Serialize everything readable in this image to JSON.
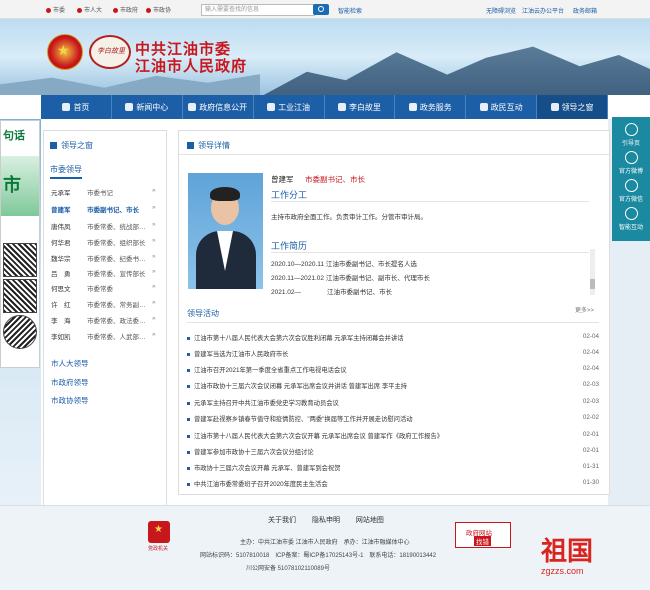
{
  "topbar": {
    "left_links": [
      "市委",
      "市人大",
      "市政府",
      "市政协"
    ],
    "search_placeholder": "输入需要查找的信息",
    "advanced_search": "智能检索",
    "right_links": [
      "无障碍浏览",
      "江油云办公平台",
      "政务邮箱"
    ]
  },
  "header": {
    "title_line1": "中共江油市委",
    "title_line2": "江油市人民政府",
    "logo_text": "李白故里"
  },
  "nav": [
    {
      "label": "首页",
      "icon": "home-icon"
    },
    {
      "label": "新闻中心",
      "icon": "news-icon"
    },
    {
      "label": "政府信息公开",
      "icon": "info-icon"
    },
    {
      "label": "工业江油",
      "icon": "industry-icon"
    },
    {
      "label": "李白故里",
      "icon": "culture-icon"
    },
    {
      "label": "政务服务",
      "icon": "service-icon"
    },
    {
      "label": "政民互动",
      "icon": "interaction-icon"
    },
    {
      "label": "领导之窗",
      "icon": "leader-icon"
    }
  ],
  "left_ad": {
    "text1": "句话",
    "text2": "市"
  },
  "side_panel": [
    "引导页",
    "官方微博",
    "官方微信",
    "智能互动"
  ],
  "left": {
    "heading": "领导之窗",
    "subheading": "市委领导",
    "leaders": [
      {
        "name": "元承军",
        "post": "市委书记"
      },
      {
        "name": "曾建军",
        "post": "市委副书记、市长",
        "selected": true
      },
      {
        "name": "唐伟凤",
        "post": "市委常委、统战部…"
      },
      {
        "name": "何华君",
        "post": "市委常委、组织部长"
      },
      {
        "name": "魏华宗",
        "post": "市委常委、纪委书…"
      },
      {
        "name": "吕　勇",
        "post": "市委常委、宣传部长"
      },
      {
        "name": "何思文",
        "post": "市委常委"
      },
      {
        "name": "许　红",
        "post": "市委常委、常务副…"
      },
      {
        "name": "李　海",
        "post": "市委常委、政法委…"
      },
      {
        "name": "李如凯",
        "post": "市委常委、人武部…"
      }
    ],
    "links": [
      "市人大领导",
      "市政府领导",
      "市政协领导"
    ]
  },
  "main": {
    "heading": "领导详情",
    "name": "曾建军",
    "title": "市委副书记、市长",
    "duty_heading": "工作分工",
    "duty_text": "主持市政府全面工作。负责审计工作。分管市审计局。",
    "resume_heading": "工作简历",
    "resume": [
      "2020.10—2020.11 江油市委副书记、市长提名人选",
      "2020.11—2021.02 江油市委副书记、副市长、代理市长",
      "2021.02—　　　　江油市委副书记、市长"
    ],
    "activity_heading": "领导活动",
    "more": "更多>>",
    "activities": [
      {
        "text": "江油市第十八届人民代表大会第六次会议胜利闭幕 元承军主持闭幕会并讲话",
        "date": "02-04"
      },
      {
        "text": "曾建军当选为江油市人民政府市长",
        "date": "02-04"
      },
      {
        "text": "江油市召开2021年第一季度全省重点工作电视电话会议",
        "date": "02-04"
      },
      {
        "text": "江油市政协十三届六次会议闭幕 元承军出席会议并讲话 曾建军出席 李平主持",
        "date": "02-03"
      },
      {
        "text": "元承军主持召开中共江油市委党史学习教育动员会议",
        "date": "02-03"
      },
      {
        "text": "曾建军赴视察乡镇春节值守和疫情防控、\"两委\"换届等工作并开展走访慰问活动",
        "date": "02-02"
      },
      {
        "text": "江油市第十八届人民代表大会第六次会议开幕 元承军出席会议 曾建军作《政府工作报告》",
        "date": "02-01"
      },
      {
        "text": "曾建军参加市政协十三届六次会议分组讨论",
        "date": "02-01"
      },
      {
        "text": "市政协十三届六次会议开幕 元承军、曾建军到会祝贺",
        "date": "01-31"
      },
      {
        "text": "中共江油市委常委班子召开2020年度民主生活会",
        "date": "01-30"
      }
    ]
  },
  "footer": {
    "links": [
      "关于我们",
      "隐私申明",
      "网站地图"
    ],
    "sponsor": "主办：中共江油市委 江油市人民政府　承办：江油市融媒体中心",
    "site_id": "网站标识码：5107810018　ICP备案：蜀ICP备17025143号-1　联系电话：18190013442",
    "police": "川公网安备 51078102110089号",
    "badge1": "党政机关",
    "badge2_line1": "政府网站",
    "badge2_line2": "找错"
  },
  "watermark": {
    "title": "祖国",
    "site": "zgzzs.com"
  }
}
